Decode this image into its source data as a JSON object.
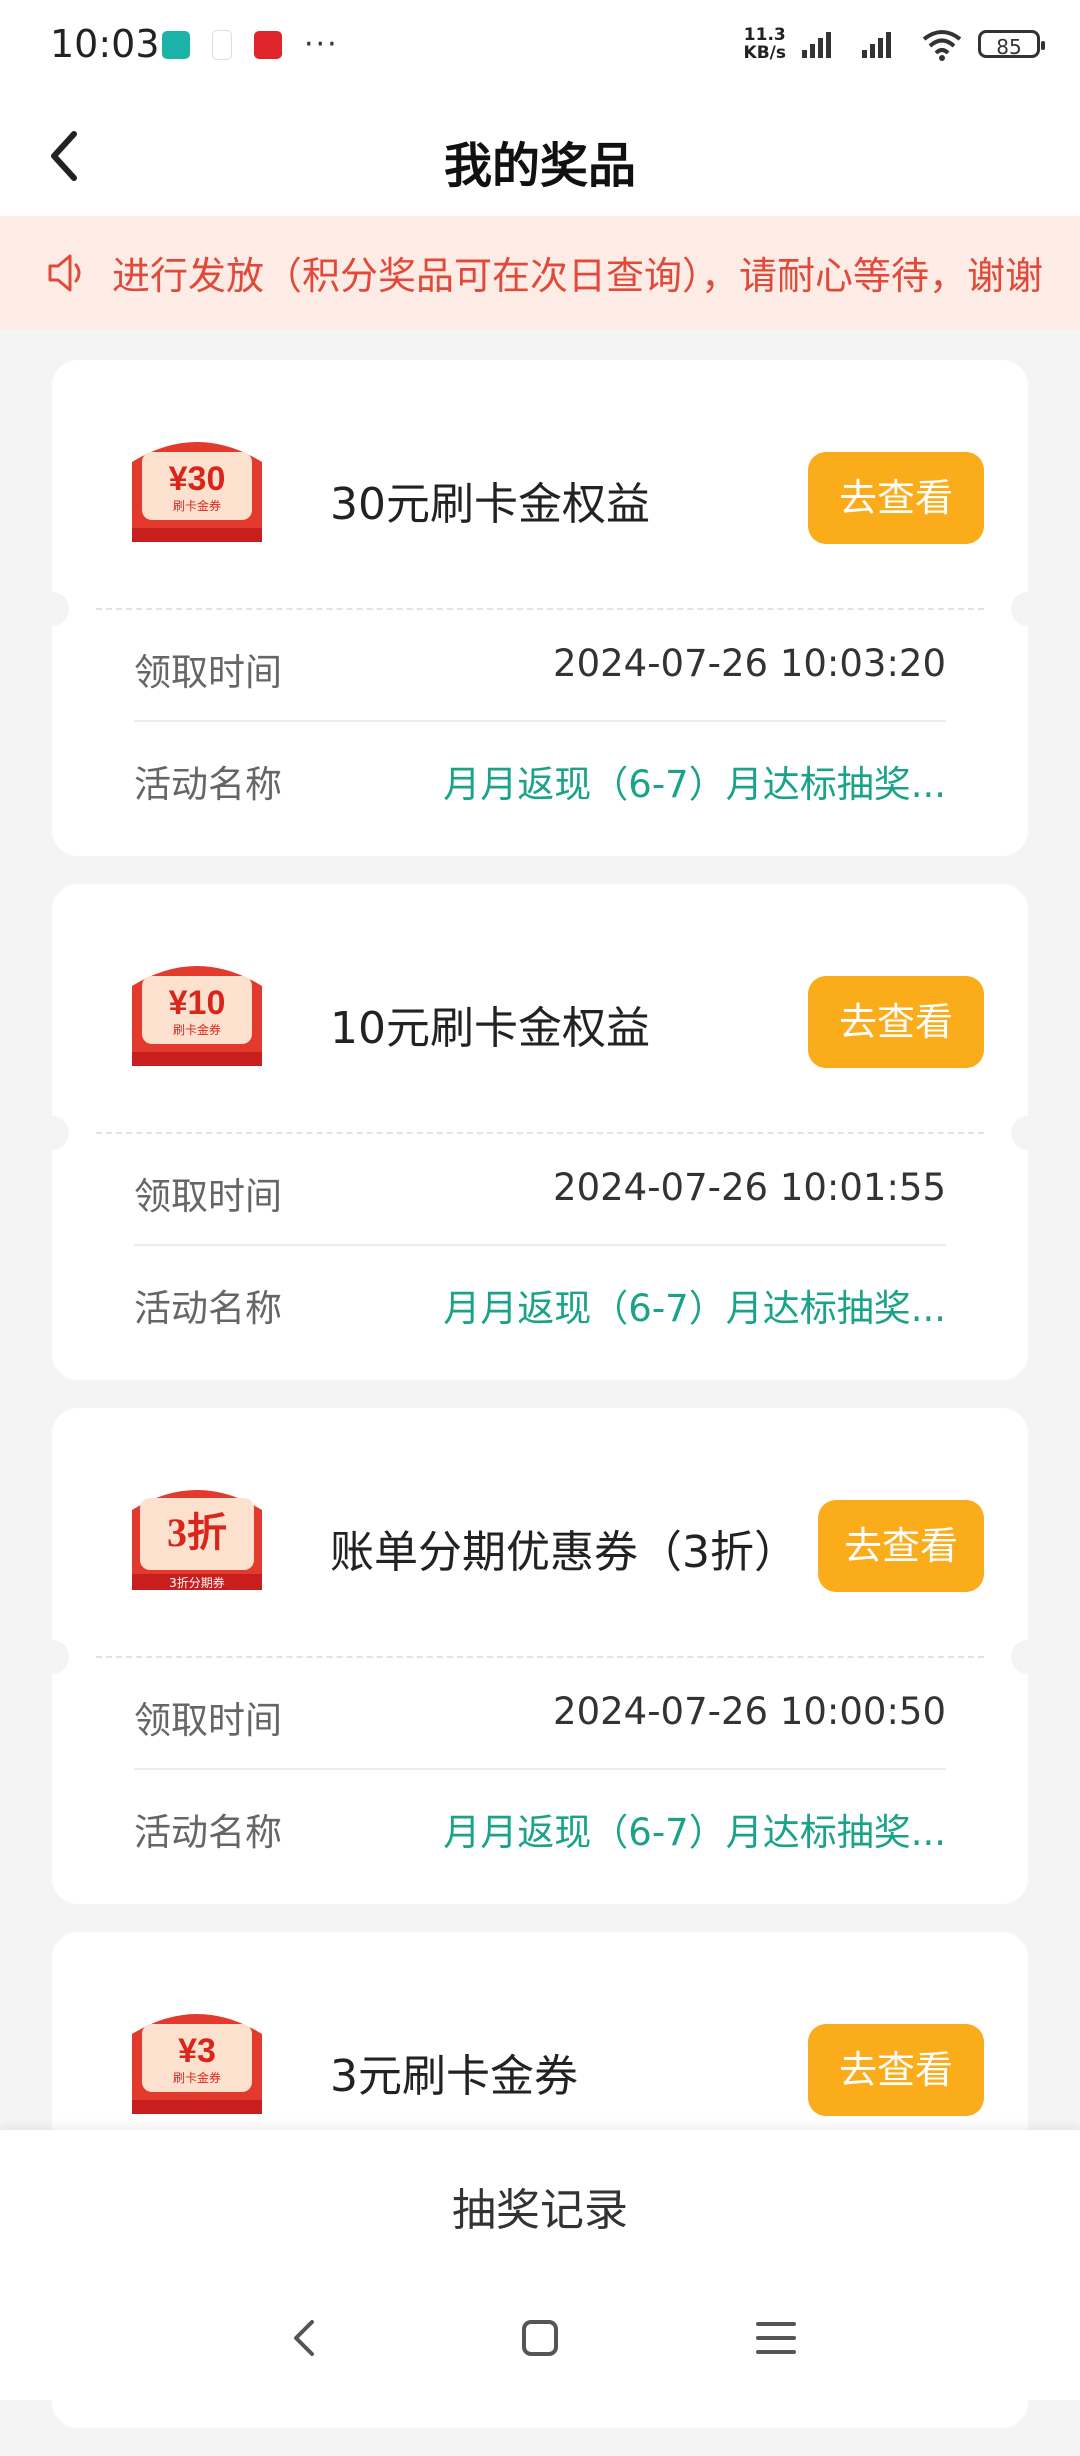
{
  "status_bar": {
    "time": "10:03",
    "net_speed_value": "11.3",
    "net_speed_unit": "KB/s",
    "battery": "85",
    "more": "···"
  },
  "header": {
    "title": "我的奖品"
  },
  "notice": {
    "text": "进行发放（积分奖品可在次日查询），请耐心等待，谢谢"
  },
  "labels": {
    "time_label": "领取时间",
    "activity_label": "活动名称",
    "view_button": "去查看"
  },
  "prizes": [
    {
      "name": "30元刷卡金权益",
      "badge": "¥30",
      "badge_sub": "刷卡金券",
      "time": "2024-07-26 10:03:20",
      "activity": "月月返现（6-7）月达标抽奖..."
    },
    {
      "name": "10元刷卡金权益",
      "badge": "¥10",
      "badge_sub": "刷卡金券",
      "time": "2024-07-26 10:01:55",
      "activity": "月月返现（6-7）月达标抽奖..."
    },
    {
      "name": "账单分期优惠券（3折）",
      "badge": "3折",
      "badge_sub": "3折分期券",
      "time": "2024-07-26 10:00:50",
      "activity": "月月返现（6-7）月达标抽奖..."
    },
    {
      "name": "3元刷卡金券",
      "badge": "¥3",
      "badge_sub": "刷卡金券"
    }
  ],
  "bottom": {
    "record_button": "抽奖记录"
  },
  "colors": {
    "accent": "#fbac1b",
    "activity_text": "#1aa389",
    "notice_bg": "#fdece5",
    "notice_text": "#e04a3a"
  }
}
